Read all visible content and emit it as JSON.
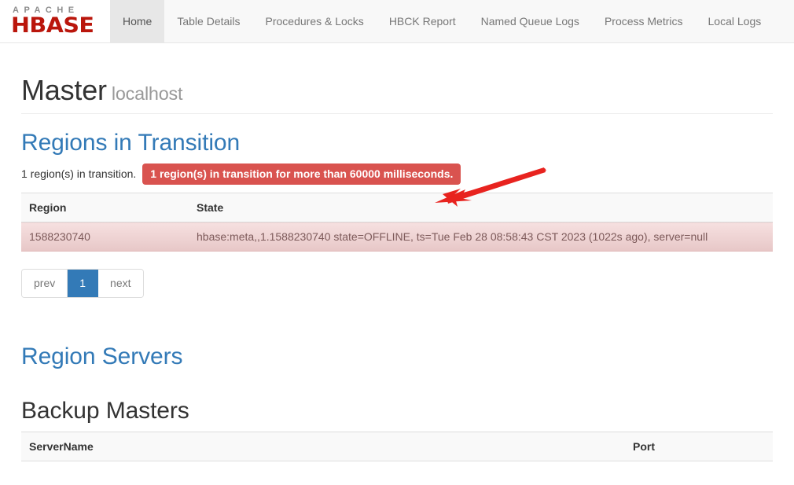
{
  "navbar": {
    "brand": {
      "top_text": "APACHE",
      "bottom_text": "HBASE"
    },
    "items": [
      {
        "label": "Home",
        "active": true
      },
      {
        "label": "Table Details",
        "active": false
      },
      {
        "label": "Procedures & Locks",
        "active": false
      },
      {
        "label": "HBCK Report",
        "active": false
      },
      {
        "label": "Named Queue Logs",
        "active": false
      },
      {
        "label": "Process Metrics",
        "active": false
      },
      {
        "label": "Local Logs",
        "active": false
      }
    ]
  },
  "page_header": {
    "title": "Master",
    "subtitle": "localhost"
  },
  "regions_in_transition": {
    "heading": "Regions in Transition",
    "summary_text": "1 region(s) in transition.",
    "warning_badge": "1 region(s) in transition for more than 60000 milliseconds.",
    "table": {
      "columns": [
        "Region",
        "State"
      ],
      "rows": [
        {
          "region": "1588230740",
          "state": "hbase:meta,,1.1588230740 state=OFFLINE, ts=Tue Feb 28 08:58:43 CST 2023 (1022s ago), server=null"
        }
      ]
    },
    "pagination": {
      "prev_label": "prev",
      "pages": [
        "1"
      ],
      "next_label": "next",
      "current_page": "1"
    }
  },
  "region_servers": {
    "heading": "Region Servers"
  },
  "backup_masters": {
    "heading": "Backup Masters",
    "table": {
      "columns": [
        "ServerName",
        "Port"
      ]
    }
  },
  "annotation": {
    "arrow_color": "#e8231f",
    "arrow_name": "red-pointer-arrow"
  },
  "colors": {
    "brand_red": "#ba160c",
    "link_blue": "#337ab7",
    "danger_red": "#d9534f",
    "navbar_bg": "#f8f8f8",
    "active_tab_bg": "#e7e7e7"
  }
}
